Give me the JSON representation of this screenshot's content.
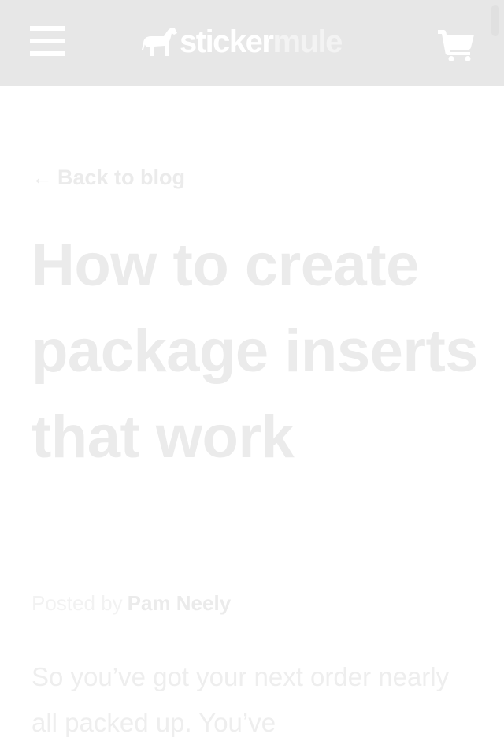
{
  "header": {
    "menu_icon": "hamburger-menu-icon",
    "logo": {
      "part1": "sticker",
      "part2": "mule",
      "icon": "horse-logo-icon"
    },
    "cart_icon": "shopping-cart-icon"
  },
  "colors": {
    "header_bg": "#e7e7e7",
    "text_faint": "#ebebeb",
    "page_bg": "#ffffff"
  },
  "article": {
    "back_arrow": "←",
    "back_label": "Back to blog",
    "title": "How to create package inserts that work",
    "byline_prefix": "Posted by",
    "author": "Pam Neely",
    "body_excerpt": "So you’ve got your next order nearly all packed up. You’ve"
  }
}
